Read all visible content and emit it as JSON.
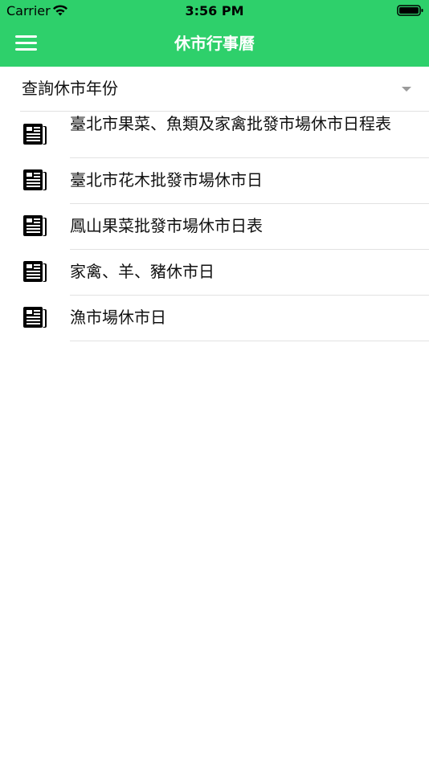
{
  "status_bar": {
    "carrier": "Carrier",
    "time": "3:56 PM",
    "icons": [
      "wifi-icon",
      "battery-icon"
    ]
  },
  "nav": {
    "title": "休市行事曆",
    "menu_icon": "hamburger-menu-icon"
  },
  "year_select": {
    "label": "查詢休市年份",
    "icon": "chevron-down-icon"
  },
  "list": {
    "icon": "newspaper-icon",
    "items": [
      {
        "label": "臺北市果菜、魚類及家禽批發市場休市日程表"
      },
      {
        "label": "臺北市花木批發市場休市日"
      },
      {
        "label": "鳳山果菜批發市場休市日表"
      },
      {
        "label": "家禽、羊、豬休市日"
      },
      {
        "label": "漁市場休市日"
      }
    ]
  },
  "colors": {
    "header": "#2ed06b",
    "background": "#ffffff",
    "text": "#111111",
    "separator": "#e2e2e2"
  }
}
